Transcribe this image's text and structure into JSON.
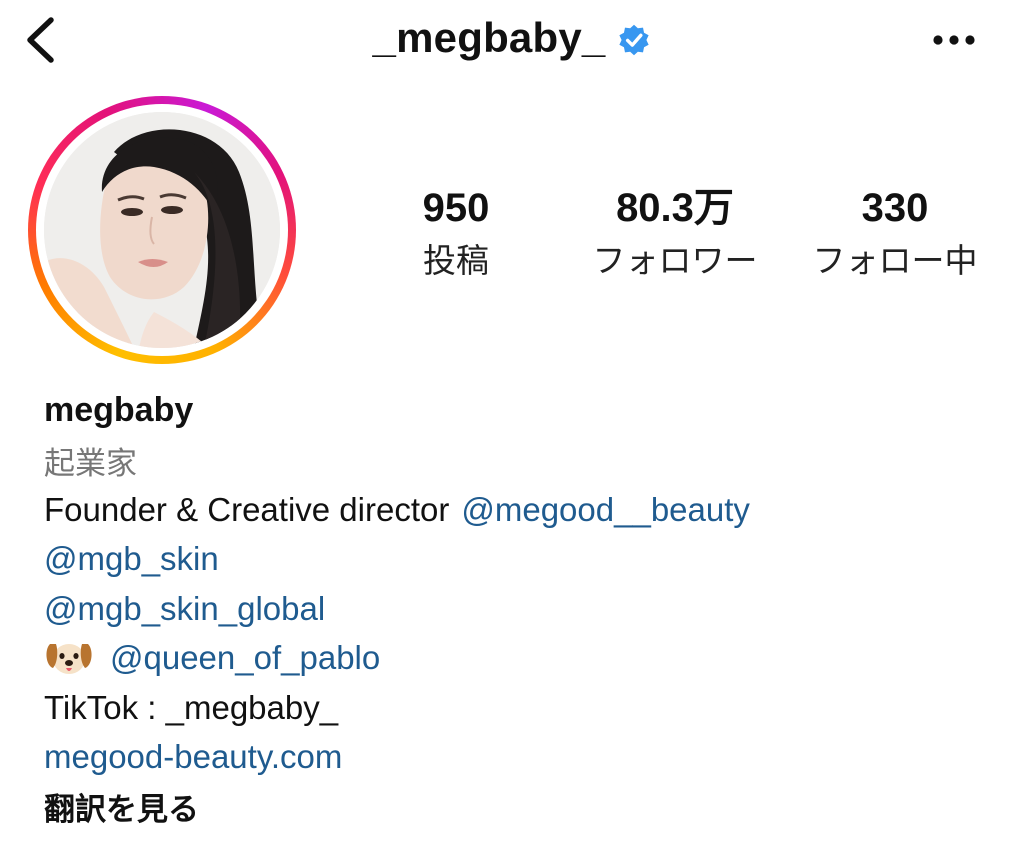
{
  "header": {
    "username": "_megbaby_",
    "back_icon": "chevron-left-icon",
    "verified_icon": "verified-badge-icon",
    "more_icon": "more-horizontal-icon",
    "verified_color": "#3897f0"
  },
  "avatar": {
    "ring_colors": [
      "#ffbf00",
      "#ff7a00",
      "#ff2d55",
      "#c91ad6"
    ]
  },
  "stats": {
    "posts": {
      "value": "950",
      "label": "投稿"
    },
    "followers": {
      "value": "80.3万",
      "label": "フォロワー"
    },
    "following": {
      "value": "330",
      "label": "フォロー中"
    }
  },
  "bio": {
    "name": "megbaby",
    "category": "起業家",
    "line1_text": "Founder & Creative director",
    "line1_mention": "@megood__beauty",
    "mention2": "@mgb_skin",
    "mention3": "@mgb_skin_global",
    "dog_icon": "dog-emoji-icon",
    "mention4": "@queen_of_pablo",
    "tiktok": "TikTok : _megbaby_",
    "website": "megood-beauty.com",
    "translate": "翻訳を見る"
  },
  "colors": {
    "link": "#1f5b8f",
    "category": "#777777",
    "text": "#111111"
  }
}
